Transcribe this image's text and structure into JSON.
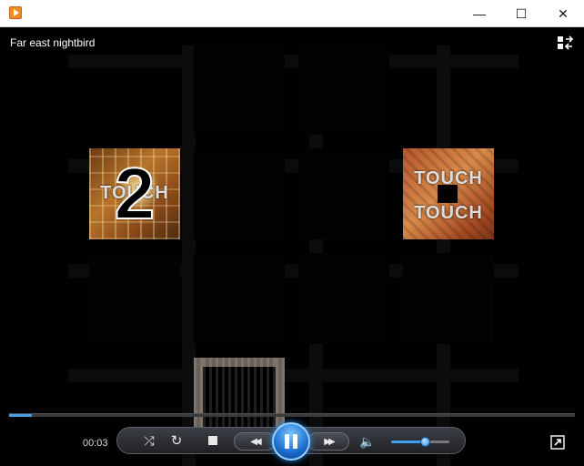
{
  "window": {
    "title": "",
    "minimize_glyph": "—",
    "maximize_glyph": "☐",
    "close_glyph": "✕"
  },
  "player": {
    "media_title": "Far east nightbird",
    "elapsed_time": "00:03",
    "seek_progress_fraction": 0.04,
    "volume_fraction": 0.58,
    "state": "playing"
  },
  "tiles": [
    {
      "text": "TOUCH",
      "overlay_digit": "2"
    },
    {
      "text_top": "TOUCH",
      "text_bottom": "TOUCH"
    }
  ],
  "icons": {
    "app": "media-player-icon",
    "switch_to_library": "switch-to-library-icon",
    "shuffle": "shuffle-icon",
    "repeat": "repeat-icon",
    "stop": "stop-icon",
    "previous": "previous-icon",
    "pause": "pause-icon",
    "next": "next-icon",
    "volume": "volume-icon",
    "fullscreen": "fullscreen-icon"
  },
  "glyphs": {
    "shuffle": "⤮",
    "repeat": "↻",
    "previous": "◀◀",
    "next": "▶▶",
    "volume": "🔈"
  },
  "colors": {
    "accent": "#3da0f0",
    "play_button": "#1a6ecf"
  }
}
